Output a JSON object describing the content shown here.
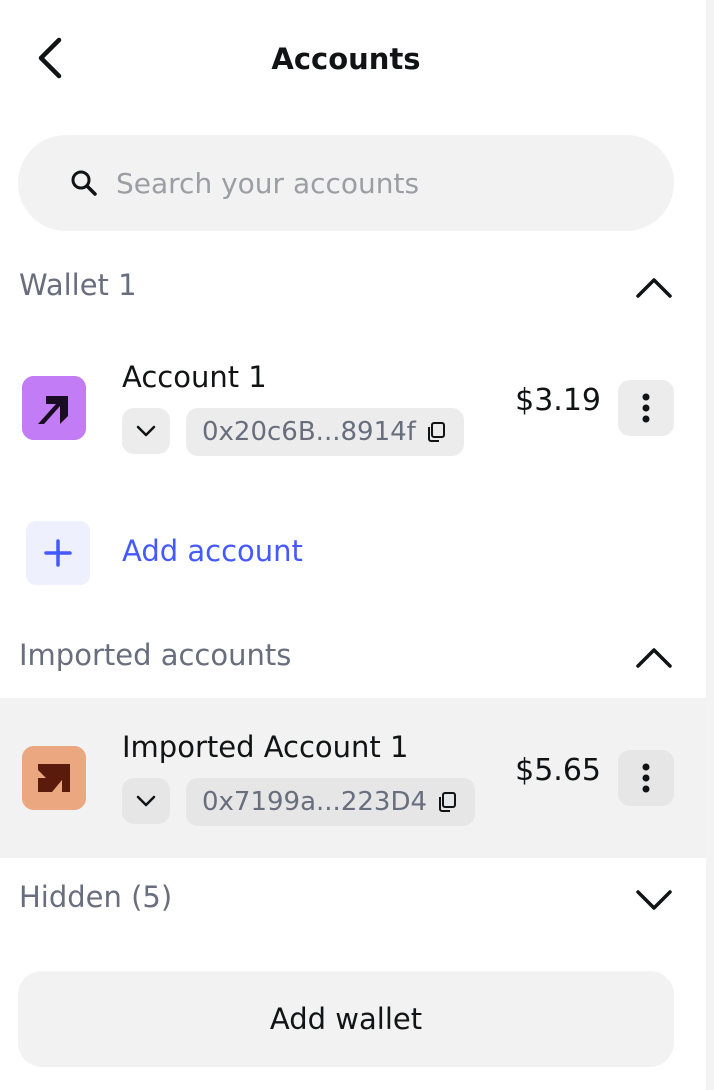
{
  "header": {
    "title": "Accounts",
    "back_icon": "chevron-left-icon"
  },
  "search": {
    "placeholder": "Search your accounts",
    "value": ""
  },
  "sections": {
    "wallet1": {
      "label": "Wallet 1",
      "expanded": true,
      "accounts": [
        {
          "name": "Account 1",
          "address": "0x20c6B...8914f",
          "balance": "$3.19",
          "avatar_color": "#c27cf5",
          "avatar_shape_color": "#1b0d21"
        }
      ],
      "add_account_label": "Add account"
    },
    "imported": {
      "label": "Imported accounts",
      "expanded": true,
      "accounts": [
        {
          "name": "Imported Account 1",
          "address": "0x7199a...223D4",
          "balance": "$5.65",
          "avatar_color": "#eba77f",
          "avatar_shape_color": "#5a1a0c",
          "selected": true
        }
      ]
    },
    "hidden": {
      "label": "Hidden (5)",
      "expanded": false
    }
  },
  "footer": {
    "add_wallet_label": "Add wallet"
  },
  "colors": {
    "accent": "#4459ff",
    "muted_text": "#686e7d",
    "surface": "#f2f2f2"
  }
}
